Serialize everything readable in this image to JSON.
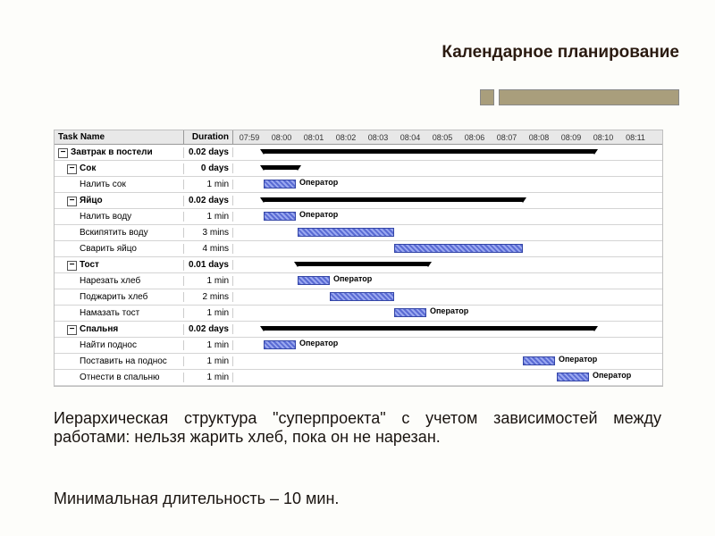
{
  "page_title": "Календарное планирование",
  "caption": "Иерархическая структура \"суперпроекта\" с учетом зависимостей между работами: нельзя жарить хлеб, пока он не нарезан.",
  "caption2": "Минимальная длительность – 10 мин.",
  "headers": {
    "task": "Task Name",
    "dur": "Duration"
  },
  "ticks": [
    "07:59",
    "08:00",
    "08:01",
    "08:02",
    "08:03",
    "08:04",
    "08:05",
    "08:06",
    "08:07",
    "08:08",
    "08:09",
    "08:10",
    "08:11"
  ],
  "rows": [
    {
      "task": "Завтрак в постели",
      "dur": "0.02 days",
      "level": 0,
      "bold": true,
      "collapse": true,
      "type": "summary",
      "start": 34,
      "len": 370
    },
    {
      "task": "Сок",
      "dur": "0 days",
      "level": 1,
      "bold": true,
      "collapse": true,
      "type": "summary",
      "start": 34,
      "len": 38
    },
    {
      "task": "Налить сок",
      "dur": "1 min",
      "level": 2,
      "type": "bar",
      "start": 34,
      "len": 36,
      "label": "Оператор"
    },
    {
      "task": "Яйцо",
      "dur": "0.02 days",
      "level": 1,
      "bold": true,
      "collapse": true,
      "type": "summary",
      "start": 34,
      "len": 290
    },
    {
      "task": "Налить воду",
      "dur": "1 min",
      "level": 2,
      "type": "bar",
      "start": 34,
      "len": 36,
      "label": "Оператор"
    },
    {
      "task": "Вскипятить воду",
      "dur": "3 mins",
      "level": 2,
      "type": "bar",
      "start": 72,
      "len": 108
    },
    {
      "task": "Сварить яйцо",
      "dur": "4 mins",
      "level": 2,
      "type": "bar",
      "start": 180,
      "len": 144
    },
    {
      "task": "Тост",
      "dur": "0.01 days",
      "level": 1,
      "bold": true,
      "collapse": true,
      "type": "summary",
      "start": 72,
      "len": 146
    },
    {
      "task": "Нарезать хлеб",
      "dur": "1 min",
      "level": 2,
      "type": "bar",
      "start": 72,
      "len": 36,
      "label": "Оператор"
    },
    {
      "task": "Поджарить хлеб",
      "dur": "2 mins",
      "level": 2,
      "type": "bar",
      "start": 108,
      "len": 72
    },
    {
      "task": "Намазать тост",
      "dur": "1 min",
      "level": 2,
      "type": "bar",
      "start": 180,
      "len": 36,
      "label": "Оператор"
    },
    {
      "task": "Спальня",
      "dur": "0.02 days",
      "level": 1,
      "bold": true,
      "collapse": true,
      "type": "summary",
      "start": 34,
      "len": 370
    },
    {
      "task": "Найти поднос",
      "dur": "1 min",
      "level": 2,
      "type": "bar",
      "start": 34,
      "len": 36,
      "label": "Оператор"
    },
    {
      "task": "Поставить на поднос",
      "dur": "1 min",
      "level": 2,
      "type": "bar",
      "start": 324,
      "len": 36,
      "label": "Оператор"
    },
    {
      "task": "Отнести в спальню",
      "dur": "1 min",
      "level": 2,
      "type": "bar",
      "start": 362,
      "len": 36,
      "label": "Оператор"
    }
  ],
  "chart_data": {
    "type": "gantt",
    "title": "Календарное планирование",
    "time_axis": {
      "start": "07:59",
      "end": "08:11",
      "unit": "min"
    },
    "resource": "Оператор",
    "tasks": [
      {
        "id": 1,
        "name": "Завтрак в постели",
        "duration": "0.02 days",
        "summary": true,
        "start": "08:00",
        "end": "08:10"
      },
      {
        "id": 2,
        "name": "Сок",
        "duration": "0 days",
        "summary": true,
        "parent": 1,
        "start": "08:00",
        "end": "08:01"
      },
      {
        "id": 3,
        "name": "Налить сок",
        "duration": "1 min",
        "parent": 2,
        "start": "08:00",
        "end": "08:01",
        "resource": "Оператор"
      },
      {
        "id": 4,
        "name": "Яйцо",
        "duration": "0.02 days",
        "summary": true,
        "parent": 1,
        "start": "08:00",
        "end": "08:08"
      },
      {
        "id": 5,
        "name": "Налить воду",
        "duration": "1 min",
        "parent": 4,
        "start": "08:00",
        "end": "08:01",
        "resource": "Оператор"
      },
      {
        "id": 6,
        "name": "Вскипятить воду",
        "duration": "3 mins",
        "parent": 4,
        "start": "08:01",
        "end": "08:04",
        "depends": [
          5
        ]
      },
      {
        "id": 7,
        "name": "Сварить яйцо",
        "duration": "4 mins",
        "parent": 4,
        "start": "08:04",
        "end": "08:08",
        "depends": [
          6
        ]
      },
      {
        "id": 8,
        "name": "Тост",
        "duration": "0.01 days",
        "summary": true,
        "parent": 1,
        "start": "08:01",
        "end": "08:05"
      },
      {
        "id": 9,
        "name": "Нарезать хлеб",
        "duration": "1 min",
        "parent": 8,
        "start": "08:01",
        "end": "08:02",
        "resource": "Оператор"
      },
      {
        "id": 10,
        "name": "Поджарить хлеб",
        "duration": "2 mins",
        "parent": 8,
        "start": "08:02",
        "end": "08:04",
        "depends": [
          9
        ]
      },
      {
        "id": 11,
        "name": "Намазать тост",
        "duration": "1 min",
        "parent": 8,
        "start": "08:04",
        "end": "08:05",
        "resource": "Оператор",
        "depends": [
          10
        ]
      },
      {
        "id": 12,
        "name": "Спальня",
        "duration": "0.02 days",
        "summary": true,
        "parent": 1,
        "start": "08:00",
        "end": "08:10"
      },
      {
        "id": 13,
        "name": "Найти поднос",
        "duration": "1 min",
        "parent": 12,
        "start": "08:00",
        "end": "08:01",
        "resource": "Оператор"
      },
      {
        "id": 14,
        "name": "Поставить на поднос",
        "duration": "1 min",
        "parent": 12,
        "start": "08:08",
        "end": "08:09",
        "resource": "Оператор",
        "depends": [
          7,
          11,
          3,
          13
        ]
      },
      {
        "id": 15,
        "name": "Отнести в спальню",
        "duration": "1 min",
        "parent": 12,
        "start": "08:09",
        "end": "08:10",
        "resource": "Оператор",
        "depends": [
          14
        ]
      }
    ]
  }
}
